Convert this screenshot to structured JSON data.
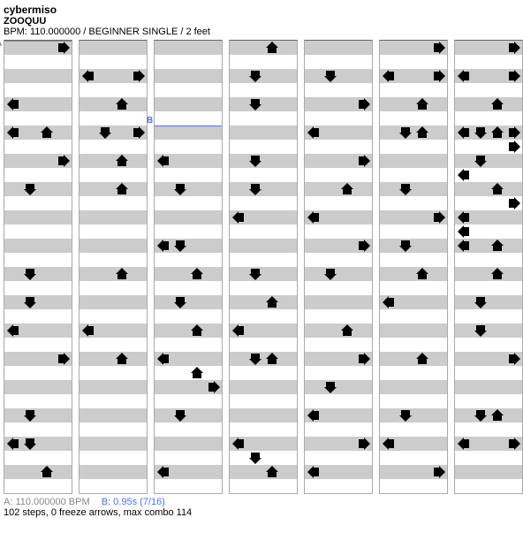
{
  "title": "cybermiso",
  "subtitle": "ZOOQUU",
  "meta": "BPM: 110.000000 / BEGINNER SINGLE / 2 feet",
  "labels": {
    "a": "A",
    "b": "B"
  },
  "section_a": {
    "column": 0,
    "row": 0
  },
  "section_b": {
    "column": 2,
    "row": 6
  },
  "footer_a": "A: 110.000000 BPM",
  "footer_b": "B: 0.95s (7/16)",
  "stats": "102 steps, 0 freeze arrows, max combo 114",
  "rows_per_column": 32,
  "chart_data": {
    "type": "stepchart",
    "lanes": [
      "left",
      "down",
      "up",
      "right"
    ],
    "columns": [
      {
        "beats": [
          {
            "row": 0,
            "arrows": [
              {
                "lane": 3,
                "color": "red"
              }
            ]
          },
          {
            "row": 4,
            "arrows": [
              {
                "lane": 0,
                "color": "red"
              }
            ]
          },
          {
            "row": 6,
            "arrows": [
              {
                "lane": 0,
                "color": "red"
              },
              {
                "lane": 2,
                "color": "red"
              }
            ]
          },
          {
            "row": 8,
            "arrows": [
              {
                "lane": 3,
                "color": "red"
              }
            ]
          },
          {
            "row": 10,
            "arrows": [
              {
                "lane": 1,
                "color": "red"
              }
            ]
          },
          {
            "row": 16,
            "arrows": [
              {
                "lane": 1,
                "color": "red"
              }
            ]
          },
          {
            "row": 18,
            "arrows": [
              {
                "lane": 1,
                "color": "red"
              }
            ]
          },
          {
            "row": 20,
            "arrows": [
              {
                "lane": 0,
                "color": "red"
              }
            ]
          },
          {
            "row": 22,
            "arrows": [
              {
                "lane": 3,
                "color": "red"
              }
            ]
          },
          {
            "row": 26,
            "arrows": [
              {
                "lane": 1,
                "color": "red"
              }
            ]
          },
          {
            "row": 28,
            "arrows": [
              {
                "lane": 0,
                "color": "red"
              },
              {
                "lane": 1,
                "color": "red"
              }
            ]
          },
          {
            "row": 30,
            "arrows": [
              {
                "lane": 2,
                "color": "red"
              }
            ]
          }
        ]
      },
      {
        "beats": [
          {
            "row": 2,
            "arrows": [
              {
                "lane": 0,
                "color": "red"
              },
              {
                "lane": 3,
                "color": "red"
              }
            ]
          },
          {
            "row": 4,
            "arrows": [
              {
                "lane": 2,
                "color": "red"
              }
            ]
          },
          {
            "row": 6,
            "arrows": [
              {
                "lane": 1,
                "color": "red"
              },
              {
                "lane": 3,
                "color": "red"
              }
            ]
          },
          {
            "row": 8,
            "arrows": [
              {
                "lane": 2,
                "color": "red"
              }
            ]
          },
          {
            "row": 10,
            "arrows": [
              {
                "lane": 2,
                "color": "red"
              }
            ]
          },
          {
            "row": 16,
            "arrows": [
              {
                "lane": 2,
                "color": "red"
              }
            ]
          },
          {
            "row": 20,
            "arrows": [
              {
                "lane": 0,
                "color": "red"
              }
            ]
          },
          {
            "row": 22,
            "arrows": [
              {
                "lane": 2,
                "color": "red"
              }
            ]
          }
        ]
      },
      {
        "beats": [
          {
            "row": 8,
            "arrows": [
              {
                "lane": 0,
                "color": "red"
              }
            ]
          },
          {
            "row": 10,
            "arrows": [
              {
                "lane": 1,
                "color": "red"
              }
            ]
          },
          {
            "row": 14,
            "arrows": [
              {
                "lane": 0,
                "color": "red"
              },
              {
                "lane": 1,
                "color": "red"
              }
            ]
          },
          {
            "row": 16,
            "arrows": [
              {
                "lane": 2,
                "color": "red"
              }
            ]
          },
          {
            "row": 18,
            "arrows": [
              {
                "lane": 1,
                "color": "red"
              }
            ]
          },
          {
            "row": 20,
            "arrows": [
              {
                "lane": 2,
                "color": "red"
              }
            ]
          },
          {
            "row": 22,
            "arrows": [
              {
                "lane": 0,
                "color": "red"
              }
            ]
          },
          {
            "row": 23,
            "arrows": [
              {
                "lane": 2,
                "color": "red"
              }
            ]
          },
          {
            "row": 24,
            "arrows": [
              {
                "lane": 3,
                "color": "red"
              }
            ]
          },
          {
            "row": 26,
            "arrows": [
              {
                "lane": 1,
                "color": "red"
              }
            ]
          },
          {
            "row": 30,
            "arrows": [
              {
                "lane": 0,
                "color": "red"
              }
            ]
          }
        ]
      },
      {
        "beats": [
          {
            "row": 0,
            "arrows": [
              {
                "lane": 2,
                "color": "red"
              }
            ]
          },
          {
            "row": 2,
            "arrows": [
              {
                "lane": 1,
                "color": "red"
              }
            ]
          },
          {
            "row": 4,
            "arrows": [
              {
                "lane": 1,
                "color": "red"
              }
            ]
          },
          {
            "row": 8,
            "arrows": [
              {
                "lane": 1,
                "color": "red"
              }
            ]
          },
          {
            "row": 10,
            "arrows": [
              {
                "lane": 1,
                "color": "red"
              }
            ]
          },
          {
            "row": 12,
            "arrows": [
              {
                "lane": 0,
                "color": "red"
              }
            ]
          },
          {
            "row": 16,
            "arrows": [
              {
                "lane": 1,
                "color": "red"
              }
            ]
          },
          {
            "row": 18,
            "arrows": [
              {
                "lane": 2,
                "color": "red"
              }
            ]
          },
          {
            "row": 20,
            "arrows": [
              {
                "lane": 0,
                "color": "red"
              }
            ]
          },
          {
            "row": 22,
            "arrows": [
              {
                "lane": 1,
                "color": "red"
              },
              {
                "lane": 2,
                "color": "red"
              }
            ]
          },
          {
            "row": 28,
            "arrows": [
              {
                "lane": 0,
                "color": "red"
              }
            ]
          },
          {
            "row": 29,
            "arrows": [
              {
                "lane": 1,
                "color": "red"
              }
            ]
          },
          {
            "row": 30,
            "arrows": [
              {
                "lane": 2,
                "color": "red"
              }
            ]
          }
        ]
      },
      {
        "beats": [
          {
            "row": 2,
            "arrows": [
              {
                "lane": 1,
                "color": "red"
              }
            ]
          },
          {
            "row": 4,
            "arrows": [
              {
                "lane": 3,
                "color": "red"
              }
            ]
          },
          {
            "row": 6,
            "arrows": [
              {
                "lane": 0,
                "color": "red"
              }
            ]
          },
          {
            "row": 8,
            "arrows": [
              {
                "lane": 3,
                "color": "red"
              }
            ]
          },
          {
            "row": 10,
            "arrows": [
              {
                "lane": 2,
                "color": "red"
              }
            ]
          },
          {
            "row": 12,
            "arrows": [
              {
                "lane": 0,
                "color": "red"
              }
            ]
          },
          {
            "row": 14,
            "arrows": [
              {
                "lane": 3,
                "color": "red"
              }
            ]
          },
          {
            "row": 16,
            "arrows": [
              {
                "lane": 1,
                "color": "red"
              }
            ]
          },
          {
            "row": 20,
            "arrows": [
              {
                "lane": 2,
                "color": "red"
              }
            ]
          },
          {
            "row": 22,
            "arrows": [
              {
                "lane": 3,
                "color": "red"
              }
            ]
          },
          {
            "row": 24,
            "arrows": [
              {
                "lane": 1,
                "color": "red"
              }
            ]
          },
          {
            "row": 26,
            "arrows": [
              {
                "lane": 0,
                "color": "red"
              }
            ]
          },
          {
            "row": 28,
            "arrows": [
              {
                "lane": 3,
                "color": "red"
              }
            ]
          },
          {
            "row": 30,
            "arrows": [
              {
                "lane": 0,
                "color": "red"
              }
            ]
          }
        ]
      },
      {
        "beats": [
          {
            "row": 0,
            "arrows": [
              {
                "lane": 3,
                "color": "red"
              }
            ]
          },
          {
            "row": 2,
            "arrows": [
              {
                "lane": 0,
                "color": "red"
              },
              {
                "lane": 3,
                "color": "red"
              }
            ]
          },
          {
            "row": 4,
            "arrows": [
              {
                "lane": 2,
                "color": "red"
              }
            ]
          },
          {
            "row": 6,
            "arrows": [
              {
                "lane": 1,
                "color": "red"
              },
              {
                "lane": 2,
                "color": "red"
              }
            ]
          },
          {
            "row": 10,
            "arrows": [
              {
                "lane": 1,
                "color": "red"
              }
            ]
          },
          {
            "row": 12,
            "arrows": [
              {
                "lane": 3,
                "color": "red"
              }
            ]
          },
          {
            "row": 14,
            "arrows": [
              {
                "lane": 1,
                "color": "red"
              }
            ]
          },
          {
            "row": 16,
            "arrows": [
              {
                "lane": 2,
                "color": "red"
              }
            ]
          },
          {
            "row": 18,
            "arrows": [
              {
                "lane": 0,
                "color": "red"
              }
            ]
          },
          {
            "row": 22,
            "arrows": [
              {
                "lane": 2,
                "color": "red"
              }
            ]
          },
          {
            "row": 26,
            "arrows": [
              {
                "lane": 1,
                "color": "red"
              }
            ]
          },
          {
            "row": 28,
            "arrows": [
              {
                "lane": 0,
                "color": "red"
              }
            ]
          },
          {
            "row": 30,
            "arrows": [
              {
                "lane": 3,
                "color": "red"
              }
            ]
          }
        ]
      },
      {
        "beats": [
          {
            "row": 0,
            "arrows": [
              {
                "lane": 3,
                "color": "red"
              }
            ]
          },
          {
            "row": 2,
            "arrows": [
              {
                "lane": 0,
                "color": "red"
              },
              {
                "lane": 3,
                "color": "red"
              }
            ]
          },
          {
            "row": 4,
            "arrows": [
              {
                "lane": 2,
                "color": "red"
              }
            ]
          },
          {
            "row": 6,
            "arrows": [
              {
                "lane": 0,
                "color": "red"
              },
              {
                "lane": 1,
                "color": "red"
              },
              {
                "lane": 2,
                "color": "red"
              },
              {
                "lane": 3,
                "color": "red"
              }
            ]
          },
          {
            "row": 7,
            "arrows": [
              {
                "lane": 3,
                "color": "blue"
              }
            ]
          },
          {
            "row": 8,
            "arrows": [
              {
                "lane": 1,
                "color": "red"
              }
            ]
          },
          {
            "row": 9,
            "arrows": [
              {
                "lane": 0,
                "color": "blue"
              }
            ]
          },
          {
            "row": 10,
            "arrows": [
              {
                "lane": 2,
                "color": "red"
              }
            ]
          },
          {
            "row": 11,
            "arrows": [
              {
                "lane": 3,
                "color": "blue"
              }
            ]
          },
          {
            "row": 12,
            "arrows": [
              {
                "lane": 0,
                "color": "red"
              }
            ]
          },
          {
            "row": 13,
            "arrows": [
              {
                "lane": 0,
                "color": "blue"
              }
            ]
          },
          {
            "row": 14,
            "arrows": [
              {
                "lane": 0,
                "color": "red"
              },
              {
                "lane": 2,
                "color": "red"
              }
            ]
          },
          {
            "row": 16,
            "arrows": [
              {
                "lane": 2,
                "color": "red"
              }
            ]
          },
          {
            "row": 18,
            "arrows": [
              {
                "lane": 1,
                "color": "red"
              }
            ]
          },
          {
            "row": 20,
            "arrows": [
              {
                "lane": 1,
                "color": "red"
              }
            ]
          },
          {
            "row": 22,
            "arrows": [
              {
                "lane": 3,
                "color": "red"
              }
            ]
          },
          {
            "row": 26,
            "arrows": [
              {
                "lane": 1,
                "color": "red"
              },
              {
                "lane": 2,
                "color": "red"
              }
            ]
          },
          {
            "row": 28,
            "arrows": [
              {
                "lane": 0,
                "color": "red"
              },
              {
                "lane": 3,
                "color": "red"
              }
            ]
          }
        ]
      }
    ]
  }
}
